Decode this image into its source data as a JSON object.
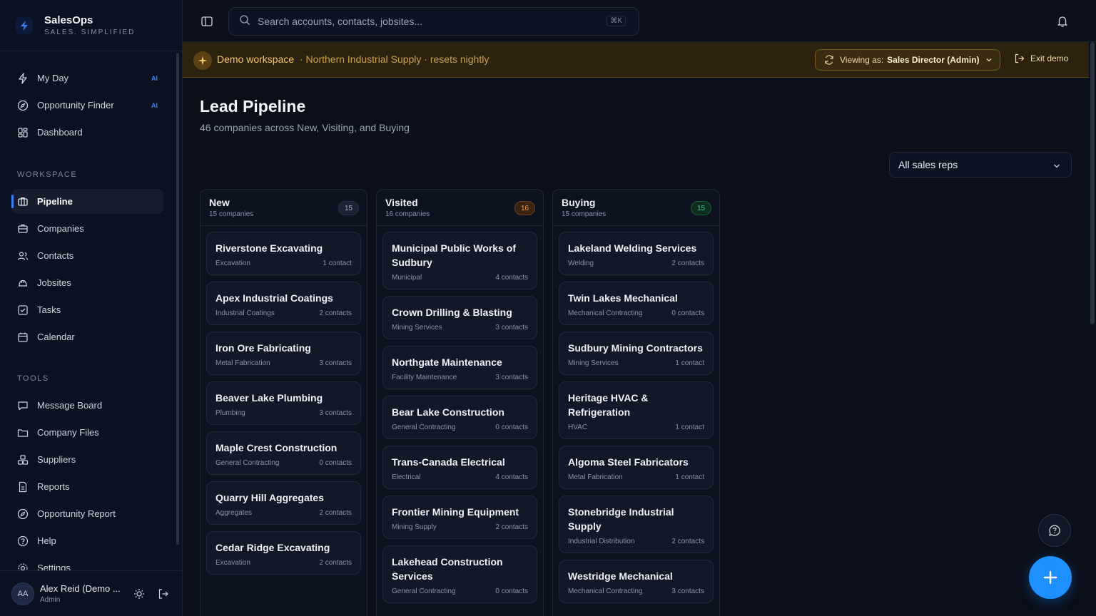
{
  "brand": {
    "name": "SalesOps",
    "tagline": "SALES. SIMPLIFIED"
  },
  "sidebar": {
    "primary": [
      {
        "label": "My Day",
        "icon": "bolt-icon",
        "badge": "AI"
      },
      {
        "label": "Opportunity Finder",
        "icon": "compass-icon",
        "badge": "AI"
      },
      {
        "label": "Dashboard",
        "icon": "dashboard-icon",
        "badge": ""
      }
    ],
    "workspace_heading": "WORKSPACE",
    "workspace": [
      {
        "label": "Pipeline",
        "icon": "kanban-icon",
        "active": true
      },
      {
        "label": "Companies",
        "icon": "building-icon"
      },
      {
        "label": "Contacts",
        "icon": "users-icon"
      },
      {
        "label": "Jobsites",
        "icon": "hard-hat-icon"
      },
      {
        "label": "Tasks",
        "icon": "checklist-icon"
      },
      {
        "label": "Calendar",
        "icon": "calendar-icon"
      }
    ],
    "tools_heading": "TOOLS",
    "tools": [
      {
        "label": "Message Board",
        "icon": "message-icon"
      },
      {
        "label": "Company Files",
        "icon": "folder-icon"
      },
      {
        "label": "Suppliers",
        "icon": "boxes-icon"
      },
      {
        "label": "Reports",
        "icon": "report-icon"
      },
      {
        "label": "Opportunity Report",
        "icon": "compass-icon"
      },
      {
        "label": "Help",
        "icon": "help-icon"
      },
      {
        "label": "Settings",
        "icon": "gear-icon"
      }
    ],
    "user": {
      "initials": "AA",
      "name": "Alex Reid (Demo ...",
      "role": "Admin"
    }
  },
  "topbar": {
    "search_placeholder": "Search accounts, contacts, jobsites...",
    "search_shortcut": "⌘K"
  },
  "demo_banner": {
    "title": "Demo workspace",
    "subtitle": "· Northern Industrial Supply · resets nightly",
    "viewing_as_label": "Viewing as:",
    "viewing_as_value": "Sales Director (Admin)",
    "exit_label": "Exit demo"
  },
  "page": {
    "title": "Lead Pipeline",
    "subtitle": "46 companies across New, Visiting, and Buying",
    "rep_filter": "All sales reps"
  },
  "columns": [
    {
      "title": "New",
      "count_label": "15 companies",
      "badge": "15",
      "cards": [
        {
          "name": "Riverstone Excavating",
          "industry": "Excavation",
          "contacts": "1 contact"
        },
        {
          "name": "Apex Industrial Coatings",
          "industry": "Industrial Coatings",
          "contacts": "2 contacts"
        },
        {
          "name": "Iron Ore Fabricating",
          "industry": "Metal Fabrication",
          "contacts": "3 contacts"
        },
        {
          "name": "Beaver Lake Plumbing",
          "industry": "Plumbing",
          "contacts": "3 contacts"
        },
        {
          "name": "Maple Crest Construction",
          "industry": "General Contracting",
          "contacts": "0 contacts"
        },
        {
          "name": "Quarry Hill Aggregates",
          "industry": "Aggregates",
          "contacts": "2 contacts"
        },
        {
          "name": "Cedar Ridge Excavating",
          "industry": "Excavation",
          "contacts": "2 contacts"
        }
      ]
    },
    {
      "title": "Visited",
      "count_label": "16 companies",
      "badge": "16",
      "cards": [
        {
          "name": "Municipal Public Works of Sudbury",
          "industry": "Municipal",
          "contacts": "4 contacts"
        },
        {
          "name": "Crown Drilling & Blasting",
          "industry": "Mining Services",
          "contacts": "3 contacts"
        },
        {
          "name": "Northgate Maintenance",
          "industry": "Facility Maintenance",
          "contacts": "3 contacts"
        },
        {
          "name": "Bear Lake Construction",
          "industry": "General Contracting",
          "contacts": "0 contacts"
        },
        {
          "name": "Trans-Canada Electrical",
          "industry": "Electrical",
          "contacts": "4 contacts"
        },
        {
          "name": "Frontier Mining Equipment",
          "industry": "Mining Supply",
          "contacts": "2 contacts"
        },
        {
          "name": "Lakehead Construction Services",
          "industry": "General Contracting",
          "contacts": "0 contacts"
        }
      ]
    },
    {
      "title": "Buying",
      "count_label": "15 companies",
      "badge": "15",
      "cards": [
        {
          "name": "Lakeland Welding Services",
          "industry": "Welding",
          "contacts": "2 contacts"
        },
        {
          "name": "Twin Lakes Mechanical",
          "industry": "Mechanical Contracting",
          "contacts": "0 contacts"
        },
        {
          "name": "Sudbury Mining Contractors",
          "industry": "Mining Services",
          "contacts": "1 contact"
        },
        {
          "name": "Heritage HVAC & Refrigeration",
          "industry": "HVAC",
          "contacts": "1 contact"
        },
        {
          "name": "Algoma Steel Fabricators",
          "industry": "Metal Fabrication",
          "contacts": "1 contact"
        },
        {
          "name": "Stonebridge Industrial Supply",
          "industry": "Industrial Distribution",
          "contacts": "2 contacts"
        },
        {
          "name": "Westridge Mechanical",
          "industry": "Mechanical Contracting",
          "contacts": "3 contacts"
        }
      ]
    }
  ],
  "colors": {
    "accent": "#3b82f6",
    "fab": "#1e90ff",
    "banner": "#2d2210",
    "visited_badge": "#f0a14a",
    "buying_badge": "#38d188"
  }
}
